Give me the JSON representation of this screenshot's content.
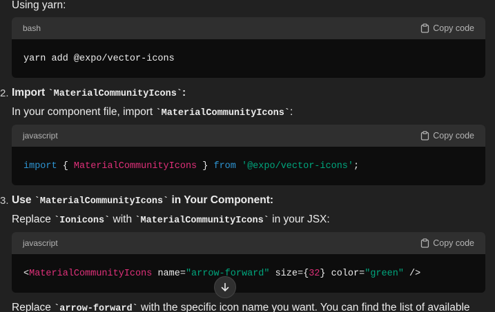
{
  "intro": {
    "label": "Using yarn:"
  },
  "blocks": [
    {
      "lang": "bash",
      "copy_label": "Copy code"
    },
    {
      "lang": "javascript",
      "copy_label": "Copy code"
    },
    {
      "lang": "javascript",
      "copy_label": "Copy code"
    }
  ],
  "code1": {
    "text": "yarn add @expo/vector-icons"
  },
  "code2": {
    "kw_import": "import",
    "brace_open": " { ",
    "name": "MaterialCommunityIcons",
    "brace_close": " } ",
    "kw_from": "from",
    "space": " ",
    "module": "'@expo/vector-icons'",
    "semi": ";"
  },
  "code3": {
    "lt": "<",
    "tag": "MaterialCommunityIcons",
    "attr_name": " name=",
    "name_val": "\"arrow-forward\"",
    "attr_size": " size={",
    "size_val": "32",
    "attr_color": "} color=",
    "color_val": "\"green\"",
    "close": " />"
  },
  "step2": {
    "number": "2.",
    "title_prefix": "Import ",
    "title_code": "`MaterialCommunityIcons`",
    "title_suffix": ":",
    "desc_prefix": "In your component file, import ",
    "desc_code": "`MaterialCommunityIcons`",
    "desc_suffix": ":"
  },
  "step3": {
    "number": "3.",
    "title_prefix": "Use ",
    "title_code": "`MaterialCommunityIcons`",
    "title_suffix": " in Your Component:",
    "desc_prefix": "Replace ",
    "desc_code1": "`Ionicons`",
    "desc_mid": " with ",
    "desc_code2": "`MaterialCommunityIcons`",
    "desc_suffix": " in your JSX:"
  },
  "footer": {
    "prefix": "Replace ",
    "code": "`arrow-forward`",
    "suffix": " with the specific icon name you want. You can find the list of available"
  }
}
